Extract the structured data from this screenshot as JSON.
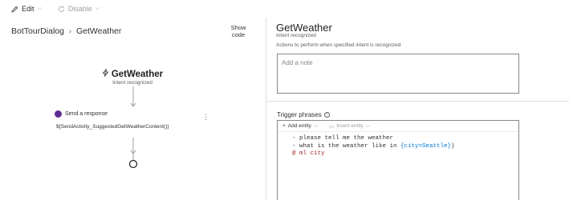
{
  "toolbar": {
    "edit_label": "Edit",
    "disable_label": "Disable"
  },
  "breadcrumb": {
    "root": "BotTourDialog",
    "current": "GetWeather"
  },
  "show_code": {
    "line1": "Show",
    "line2": "code"
  },
  "canvas": {
    "trigger_title": "GetWeather",
    "trigger_subtitle": "Intent recognized",
    "action_title": "Send a response",
    "action_body": "${SendActivity_SuggestedGetWeatherContent()}",
    "action_color": "#5c2d91"
  },
  "panel": {
    "title": "GetWeather",
    "subtitle": "Intent recognized",
    "description": "Actions to perform when specified intent is recognized",
    "note_placeholder": "Add a note",
    "trigger_label": "Trigger phrases",
    "add_entity_label": "Add entity",
    "insert_entity_label": "Insert entity",
    "lines": [
      "- please tell me the weather",
      "- what is the weather like in ",
      "{city=Seattle}",
      ")",
      "@ ml city"
    ]
  }
}
